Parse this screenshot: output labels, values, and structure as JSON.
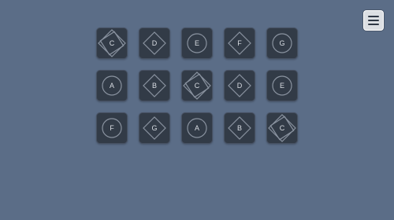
{
  "colors": {
    "background": "#5b6d87",
    "tile": "#323b47",
    "tile_border": "#465061",
    "shape_stroke": "#8a93a0",
    "letter": "#d9dde3",
    "menu_button": "#dcdfe3"
  },
  "menu": {
    "icon": "hamburger-menu-icon"
  },
  "board": {
    "rows": [
      [
        {
          "letter": "C",
          "shape": "double-diamond"
        },
        {
          "letter": "D",
          "shape": "diamond"
        },
        {
          "letter": "E",
          "shape": "circle"
        },
        {
          "letter": "F",
          "shape": "diamond"
        },
        {
          "letter": "G",
          "shape": "circle"
        }
      ],
      [
        {
          "letter": "A",
          "shape": "circle"
        },
        {
          "letter": "B",
          "shape": "diamond"
        },
        {
          "letter": "C",
          "shape": "double-diamond"
        },
        {
          "letter": "D",
          "shape": "diamond"
        },
        {
          "letter": "E",
          "shape": "circle"
        }
      ],
      [
        {
          "letter": "F",
          "shape": "circle"
        },
        {
          "letter": "G",
          "shape": "diamond"
        },
        {
          "letter": "A",
          "shape": "circle"
        },
        {
          "letter": "B",
          "shape": "diamond"
        },
        {
          "letter": "C",
          "shape": "double-diamond"
        }
      ]
    ]
  }
}
